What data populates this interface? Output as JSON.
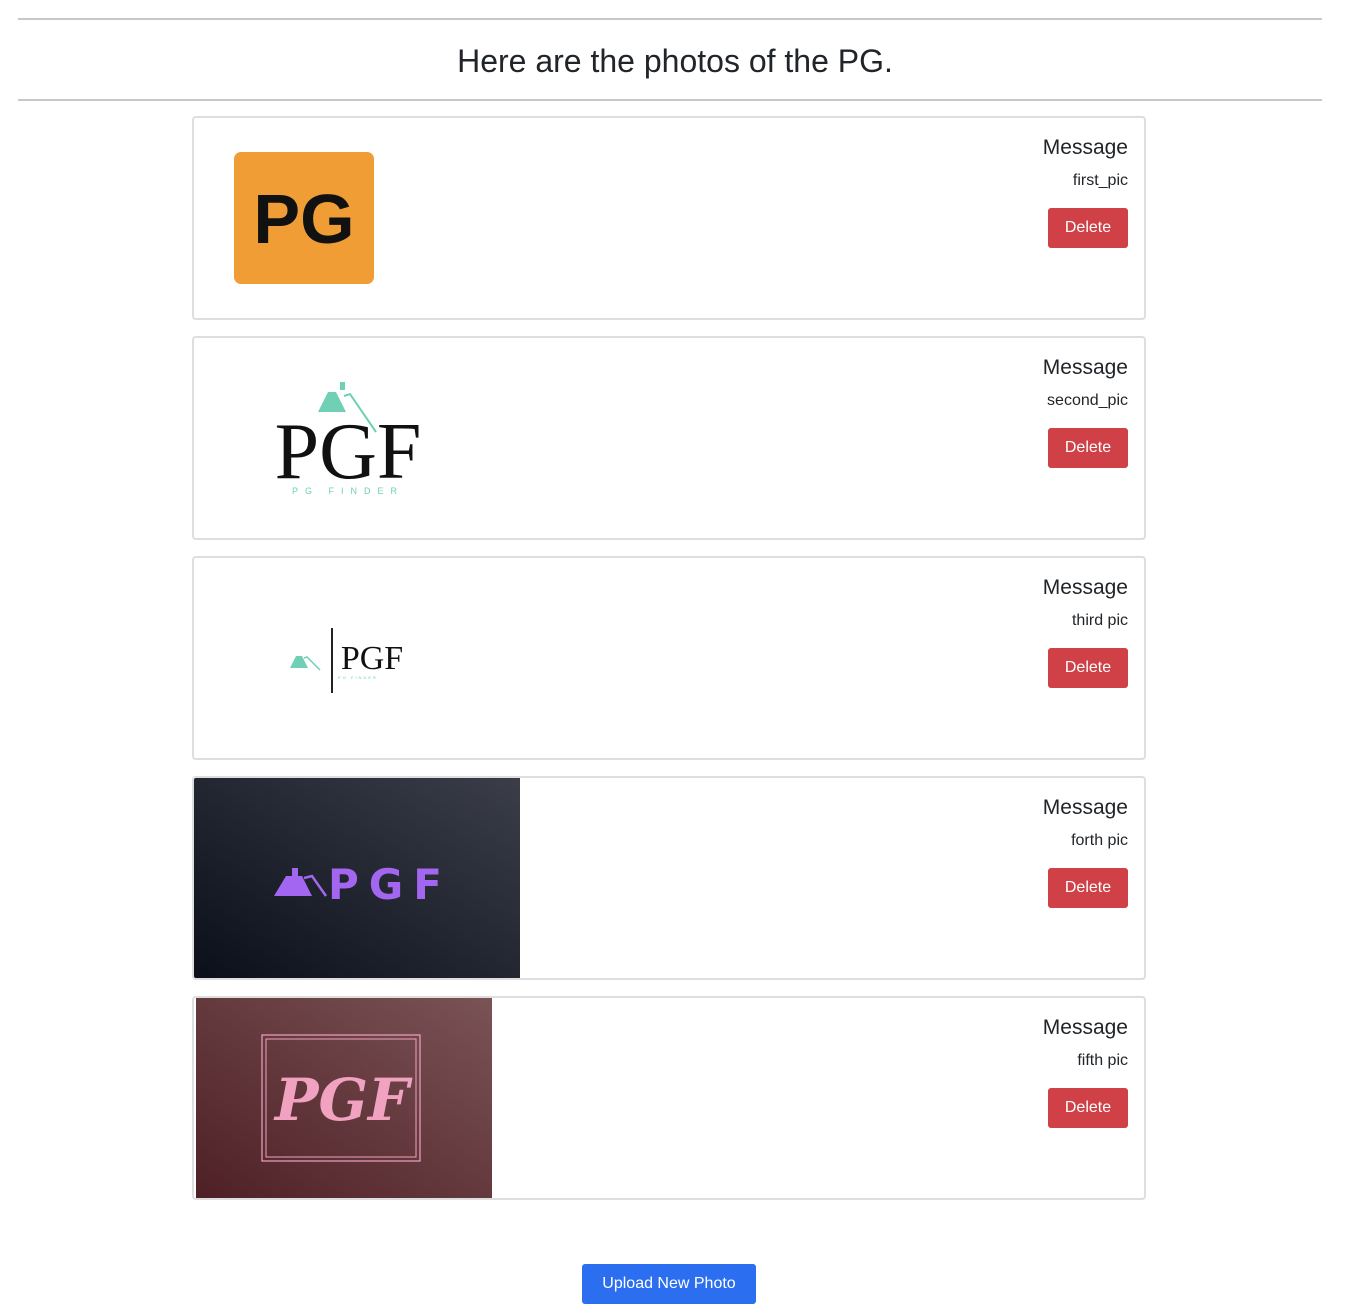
{
  "page": {
    "heading": "Here are the photos of the PG."
  },
  "photos": [
    {
      "message_label": "Message",
      "message": "first_pic",
      "delete_label": "Delete",
      "image": "pg-orange-logo"
    },
    {
      "message_label": "Message",
      "message": "second_pic",
      "delete_label": "Delete",
      "image": "pgf-pg-finder-logo"
    },
    {
      "message_label": "Message",
      "message": "third pic",
      "delete_label": "Delete",
      "image": "pgf-small-logo"
    },
    {
      "message_label": "Message",
      "message": "forth pic",
      "delete_label": "Delete",
      "image": "pgf-purple-dark-logo"
    },
    {
      "message_label": "Message",
      "message": "fifth pic",
      "delete_label": "Delete",
      "image": "pgf-pink-script-logo"
    }
  ],
  "logos": {
    "pg": "PG",
    "pgf": "PGF",
    "pg_finder": "PG FINDER"
  },
  "actions": {
    "upload_label": "Upload New Photo"
  },
  "colors": {
    "delete": "#cf4146",
    "upload": "#2b6ff0",
    "orange_logo": "#f09d36",
    "teal_roof": "#6fd0b5",
    "purple": "#a266f0",
    "pink": "#f0a2c0"
  }
}
